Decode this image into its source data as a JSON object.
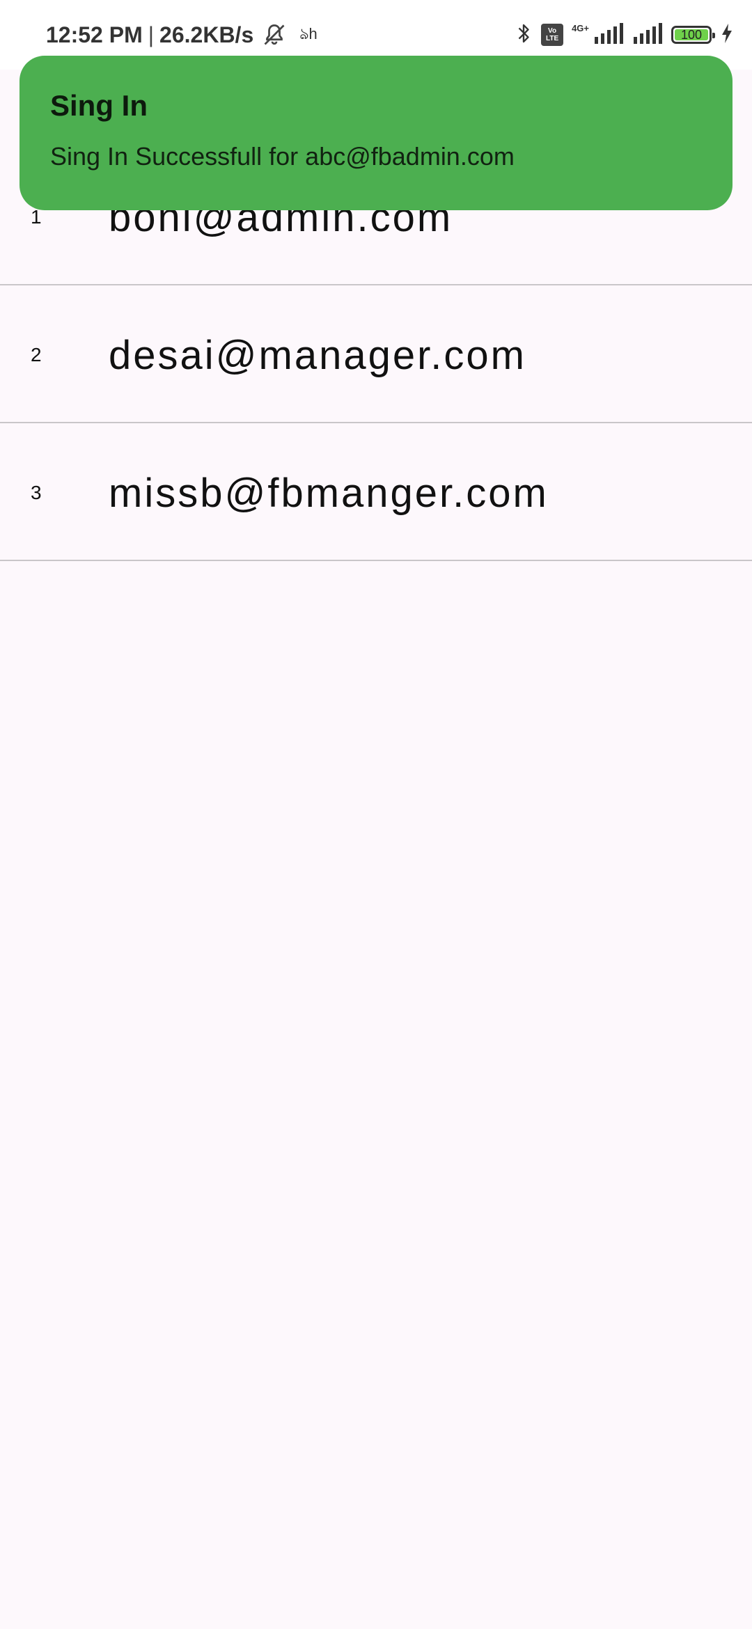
{
  "status_bar": {
    "time": "12:52 PM",
    "separator": "|",
    "speed": "26.2KB/s",
    "extra_glyph": "ঌh",
    "volte_line1": "Vo",
    "volte_line2": "LTE",
    "network_type": "4G+",
    "battery": "100",
    "battery_color": "#6fd14b"
  },
  "users": [
    {
      "index": "1",
      "email": "boni@admin.com"
    },
    {
      "index": "2",
      "email": "desai@manager.com"
    },
    {
      "index": "3",
      "email": "missb@fbmanger.com"
    }
  ],
  "toast": {
    "title": "Sing In",
    "message": "Sing In Successfull for abc@fbadmin.com",
    "background": "#4caf50"
  }
}
